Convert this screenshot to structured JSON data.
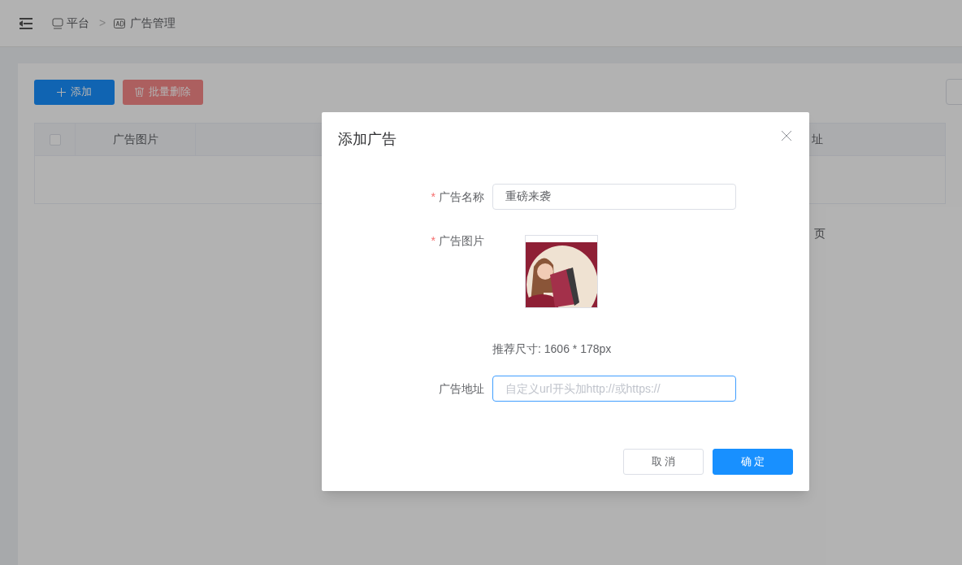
{
  "breadcrumb": [
    {
      "label": "平台",
      "kind": "home"
    },
    {
      "label": "广告管理",
      "kind": "ad"
    }
  ],
  "breadcrumb_separator": ">",
  "toolbar": [
    {
      "label": "添加",
      "kind": "add"
    },
    {
      "label": "批量删除",
      "kind": "delete"
    }
  ],
  "table": {
    "select_all_checked": false,
    "columns": [
      "广告图片",
      "址"
    ]
  },
  "pagination": {
    "page_unit": "页"
  },
  "dialog": {
    "title": "添加广告",
    "fields": [
      {
        "label": "广告名称",
        "required_mark": "*",
        "kind": "text",
        "value": "重磅来袭",
        "focused": false
      },
      {
        "label": "广告图片",
        "required_mark": "*",
        "hint": "推荐尺寸: 1606 * 178px"
      },
      {
        "label": "广告地址",
        "kind": "text",
        "placeholder": "自定义url开头加http://或https://",
        "focused": true
      }
    ],
    "buttons": [
      {
        "label": "取 消",
        "kind": "default"
      },
      {
        "label": "确 定",
        "kind": "primary"
      }
    ]
  }
}
